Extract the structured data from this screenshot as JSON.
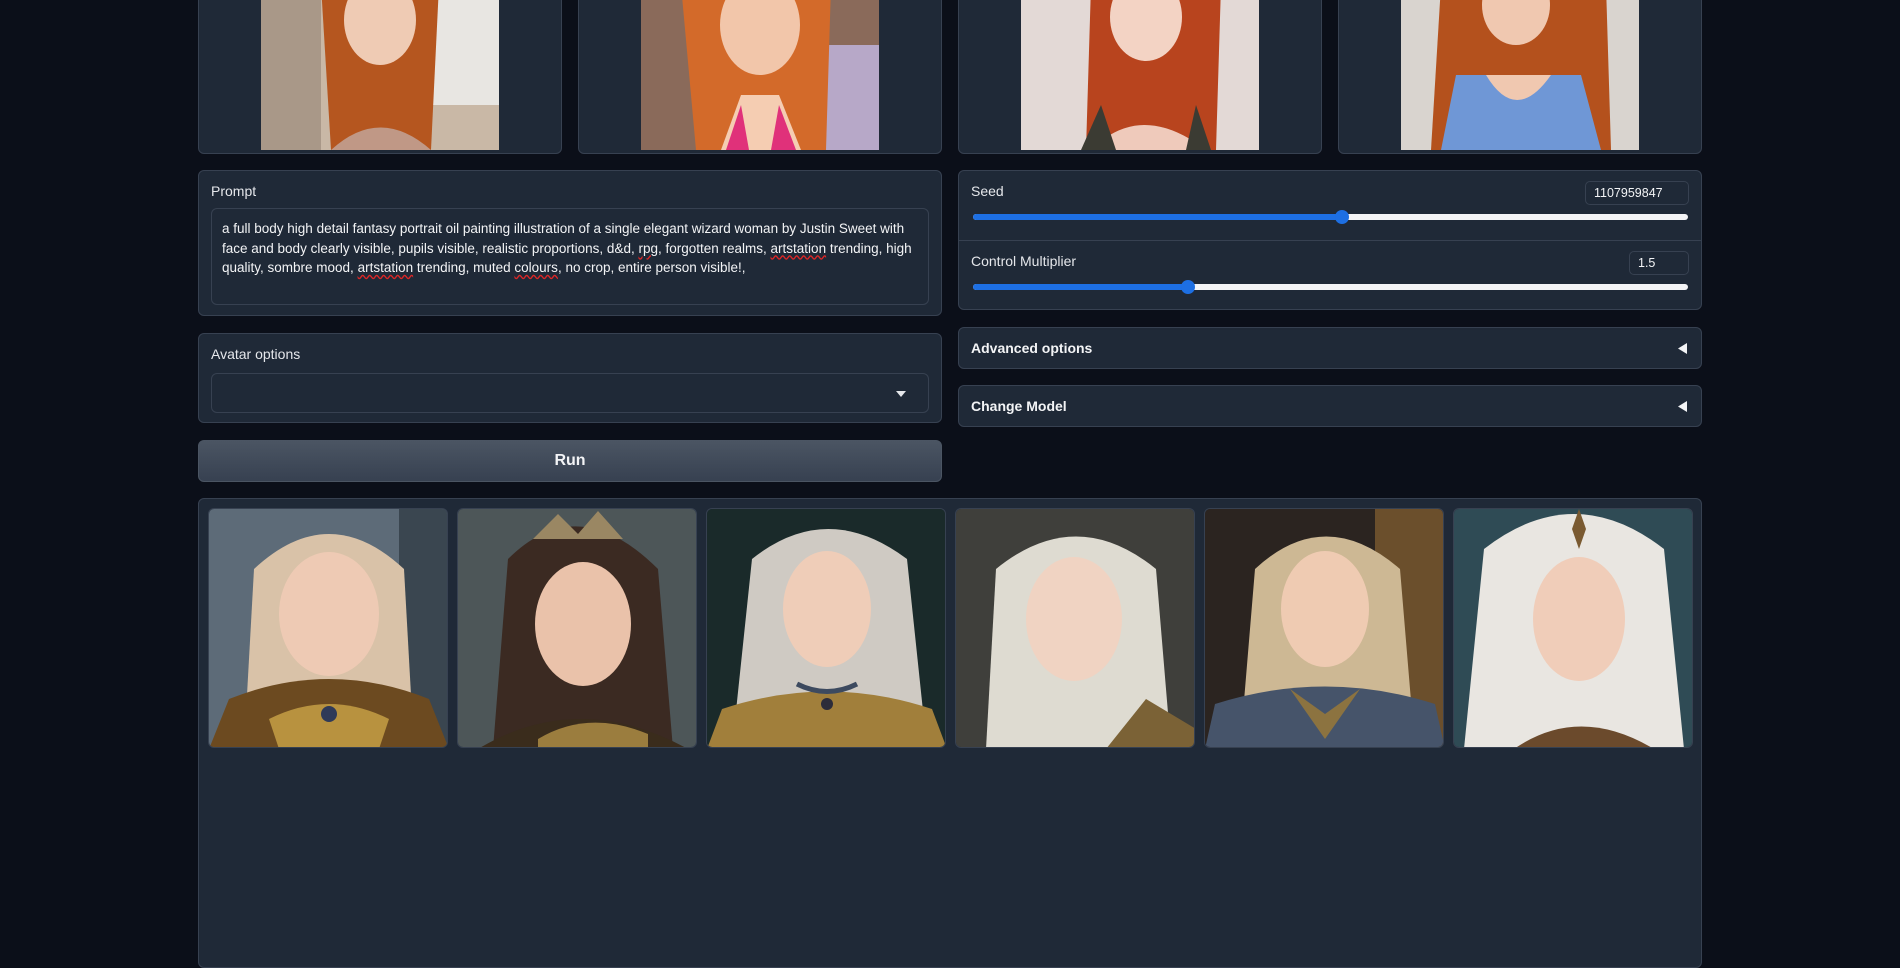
{
  "prompt": {
    "label": "Prompt",
    "value_parts": [
      "a full body high detail fantasy portrait oil painting illustration of a single elegant wizard woman by Justin Sweet with face and body clearly visible, pupils visible, realistic proportions, d&d, ",
      "rpg",
      ", forgotten realms, ",
      "artstation",
      " trending, high quality, sombre mood, ",
      "artstation",
      " trending, muted ",
      "colours",
      ", no crop, entire person visible!,"
    ]
  },
  "avatar_options": {
    "label": "Avatar options",
    "selected": ""
  },
  "run_button": "Run",
  "seed": {
    "label": "Seed",
    "value": "1107959847",
    "fraction": 0.516
  },
  "control_multiplier": {
    "label": "Control Multiplier",
    "value": "1.5",
    "fraction": 0.3
  },
  "advanced_options": {
    "label": "Advanced options",
    "icon": "triangle-left-icon"
  },
  "change_model": {
    "label": "Change Model",
    "icon": "triangle-left-icon"
  },
  "reference_images": [
    {
      "name": "reference-photo-1"
    },
    {
      "name": "reference-photo-2"
    },
    {
      "name": "reference-photo-3"
    },
    {
      "name": "reference-photo-4"
    }
  ],
  "gallery": [
    {
      "name": "generated-portrait-1"
    },
    {
      "name": "generated-portrait-2"
    },
    {
      "name": "generated-portrait-3"
    },
    {
      "name": "generated-portrait-4"
    },
    {
      "name": "generated-portrait-5"
    },
    {
      "name": "generated-portrait-6"
    }
  ],
  "colors": {
    "background": "#0b0f19",
    "panel": "#1f2937",
    "border": "#374151",
    "accent": "#1d6fe3"
  }
}
